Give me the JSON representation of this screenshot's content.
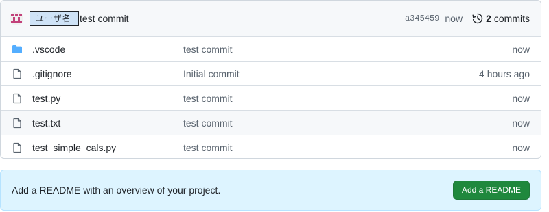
{
  "commit": {
    "user": "ユーザ名",
    "message": "test commit",
    "sha": "a345459",
    "when": "now",
    "commit_count": "2",
    "commits_label": "commits",
    "avatar_icon": "identicon-avatar",
    "history_icon": "history-icon"
  },
  "files": [
    {
      "name": ".vscode",
      "type": "folder",
      "icon": "folder-icon",
      "message": "test commit",
      "age": "now"
    },
    {
      "name": ".gitignore",
      "type": "file",
      "icon": "file-icon",
      "message": "Initial commit",
      "age": "4 hours ago"
    },
    {
      "name": "test.py",
      "type": "file",
      "icon": "file-icon",
      "message": "test commit",
      "age": "now"
    },
    {
      "name": "test.txt",
      "type": "file",
      "icon": "file-icon",
      "message": "test commit",
      "age": "now"
    },
    {
      "name": "test_simple_cals.py",
      "type": "file",
      "icon": "file-icon",
      "message": "test commit",
      "age": "now"
    }
  ],
  "readme": {
    "text": "Add a README with an overview of your project.",
    "button": "Add a README"
  },
  "colors": {
    "accent_green": "#1f883d",
    "folder_blue": "#54aeff",
    "banner_bg": "#ddf4ff",
    "avatar_pink": "#c2417a"
  }
}
